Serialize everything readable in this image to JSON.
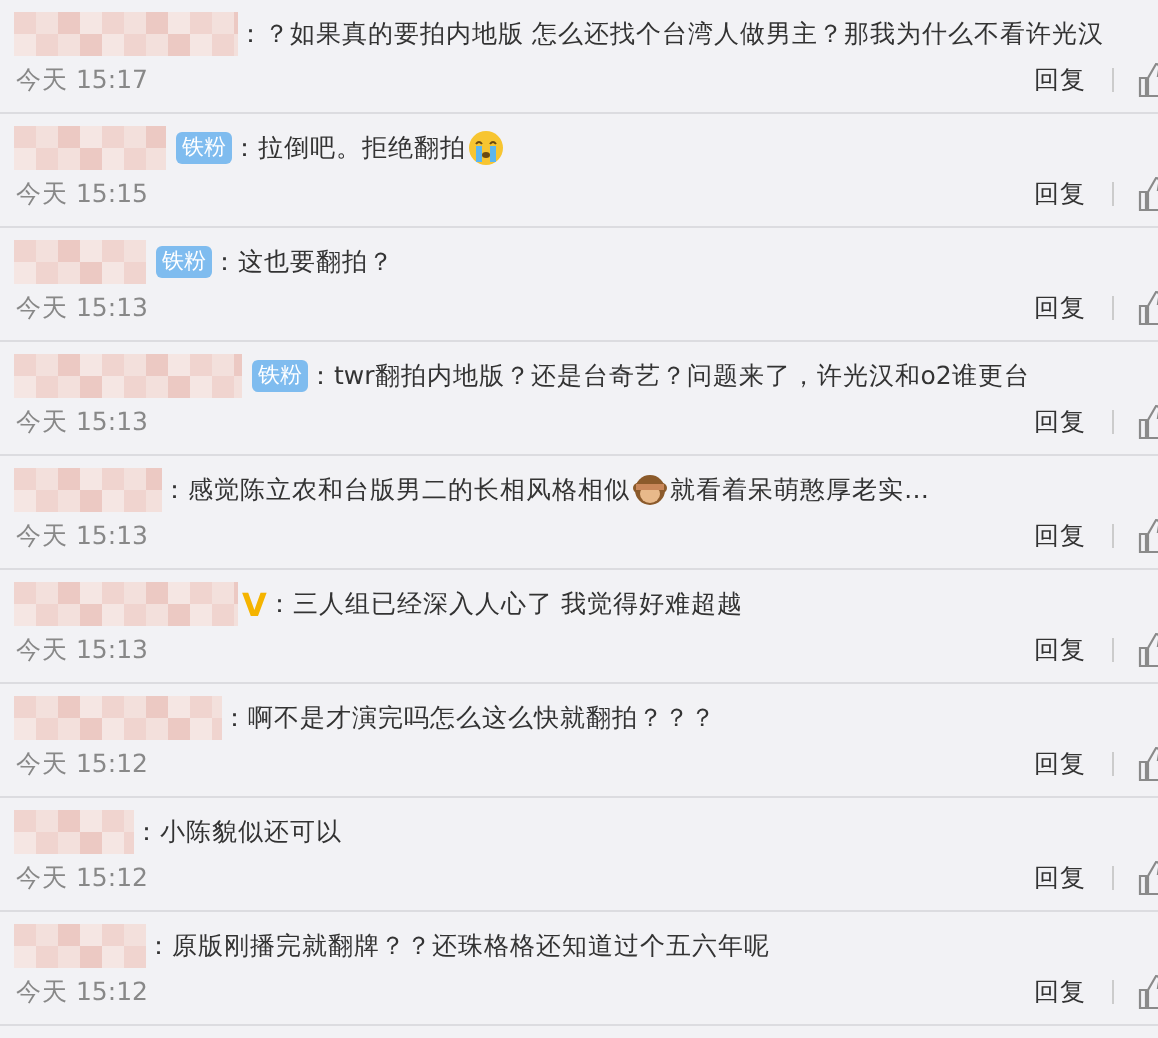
{
  "comments": [
    {
      "parts": [
        {
          "kind": "text",
          "text": "：？如果真的要拍内地版 怎么还找个台湾人做男主？那我为什么不看许光汉"
        }
      ],
      "time": "今天 15:17",
      "reply": "回复"
    },
    {
      "badge": {
        "kind": "fan",
        "text": "铁粉"
      },
      "parts": [
        {
          "kind": "text",
          "text": "：拉倒吧。拒绝翻拍"
        },
        {
          "kind": "crying"
        }
      ],
      "time": "今天 15:15",
      "reply": "回复"
    },
    {
      "badge": {
        "kind": "fan",
        "text": "铁粉"
      },
      "parts": [
        {
          "kind": "text",
          "text": "：这也要翻拍？"
        }
      ],
      "time": "今天 15:13",
      "reply": "回复"
    },
    {
      "badge": {
        "kind": "fan",
        "text": "铁粉"
      },
      "parts": [
        {
          "kind": "text",
          "text": "：twr翻拍内地版？还是台奇艺？问题来了，许光汉和o2谁更台"
        }
      ],
      "time": "今天 15:13",
      "reply": "回复"
    },
    {
      "parts": [
        {
          "kind": "text",
          "text": "：感觉陈立农和台版男二的长相风格相似"
        },
        {
          "kind": "monkey"
        },
        {
          "kind": "text",
          "text": "就看着呆萌憨厚老实…"
        }
      ],
      "time": "今天 15:13",
      "reply": "回复"
    },
    {
      "badge": {
        "kind": "verified",
        "text": "V"
      },
      "parts": [
        {
          "kind": "text",
          "text": "：三人组已经深入人心了 我觉得好难超越"
        }
      ],
      "time": "今天 15:13",
      "reply": "回复"
    },
    {
      "parts": [
        {
          "kind": "text",
          "text": "：啊不是才演完吗怎么这么快就翻拍？？？"
        }
      ],
      "time": "今天 15:12",
      "reply": "回复"
    },
    {
      "parts": [
        {
          "kind": "text",
          "text": "：小陈貌似还可以"
        }
      ],
      "time": "今天 15:12",
      "reply": "回复"
    },
    {
      "parts": [
        {
          "kind": "text",
          "text": "：原版刚播完就翻牌？？还珠格格还知道过个五六年呢"
        }
      ],
      "time": "今天 15:12",
      "reply": "回复"
    }
  ]
}
